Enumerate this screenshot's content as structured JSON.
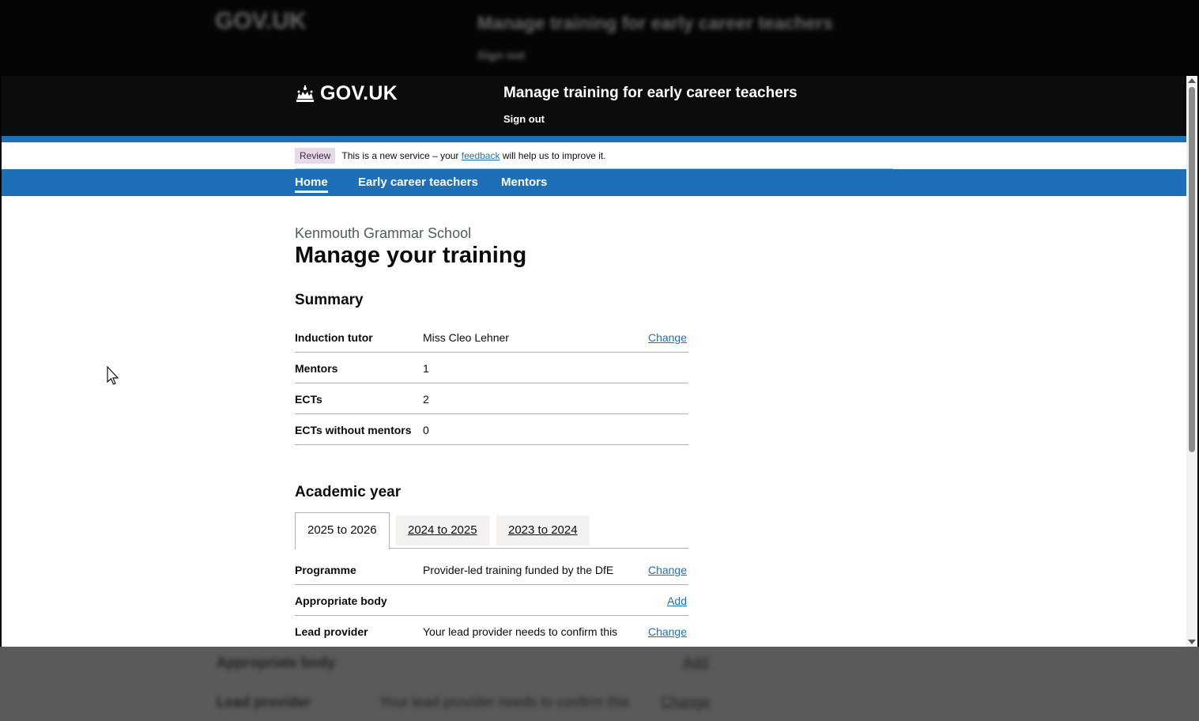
{
  "backdrop": {
    "logo_text": "GOV.UK",
    "service_name": "Manage training for early career teachers",
    "sign_out": "Sign out",
    "row1_key": "Appropriate body",
    "row1_action": "Add",
    "row2_key": "Lead provider",
    "row2_val": "Your lead provider needs to confirm this",
    "row2_action": "Change"
  },
  "header": {
    "logo_text": "GOV.UK",
    "service_name": "Manage training for early career teachers",
    "sign_out": "Sign out"
  },
  "phase_banner": {
    "tag": "Review",
    "text_before": "This is a new service – your",
    "link": "feedback",
    "text_after": "will help us to improve it."
  },
  "nav": {
    "items": [
      {
        "label": "Home"
      },
      {
        "label": "Early career teachers"
      },
      {
        "label": "Mentors"
      }
    ]
  },
  "page": {
    "caption": "Kenmouth Grammar School",
    "title": "Manage your training"
  },
  "summary": {
    "heading": "Summary",
    "rows": [
      {
        "key": "Induction tutor",
        "value": "Miss Cleo Lehner",
        "action": "Change"
      },
      {
        "key": "Mentors",
        "value": "1"
      },
      {
        "key": "ECTs",
        "value": "2"
      },
      {
        "key": "ECTs without mentors",
        "value": "0"
      }
    ]
  },
  "academic_year": {
    "heading": "Academic year",
    "tabs": [
      {
        "label": "2025 to 2026"
      },
      {
        "label": "2024 to 2025"
      },
      {
        "label": "2023 to 2024"
      }
    ],
    "rows": [
      {
        "key": "Programme",
        "value": "Provider-led training funded by the DfE",
        "action": "Change"
      },
      {
        "key": "Appropriate body",
        "value": "",
        "action": "Add"
      },
      {
        "key": "Lead provider",
        "value": "Your lead provider needs to confirm this",
        "action": "Change"
      }
    ]
  },
  "colors": {
    "header_bg": "#0b0c0c",
    "brand_blue": "#1d70b8",
    "link": "#1d70b8",
    "text": "#0b0c0c",
    "secondary_text": "#505a5f"
  }
}
